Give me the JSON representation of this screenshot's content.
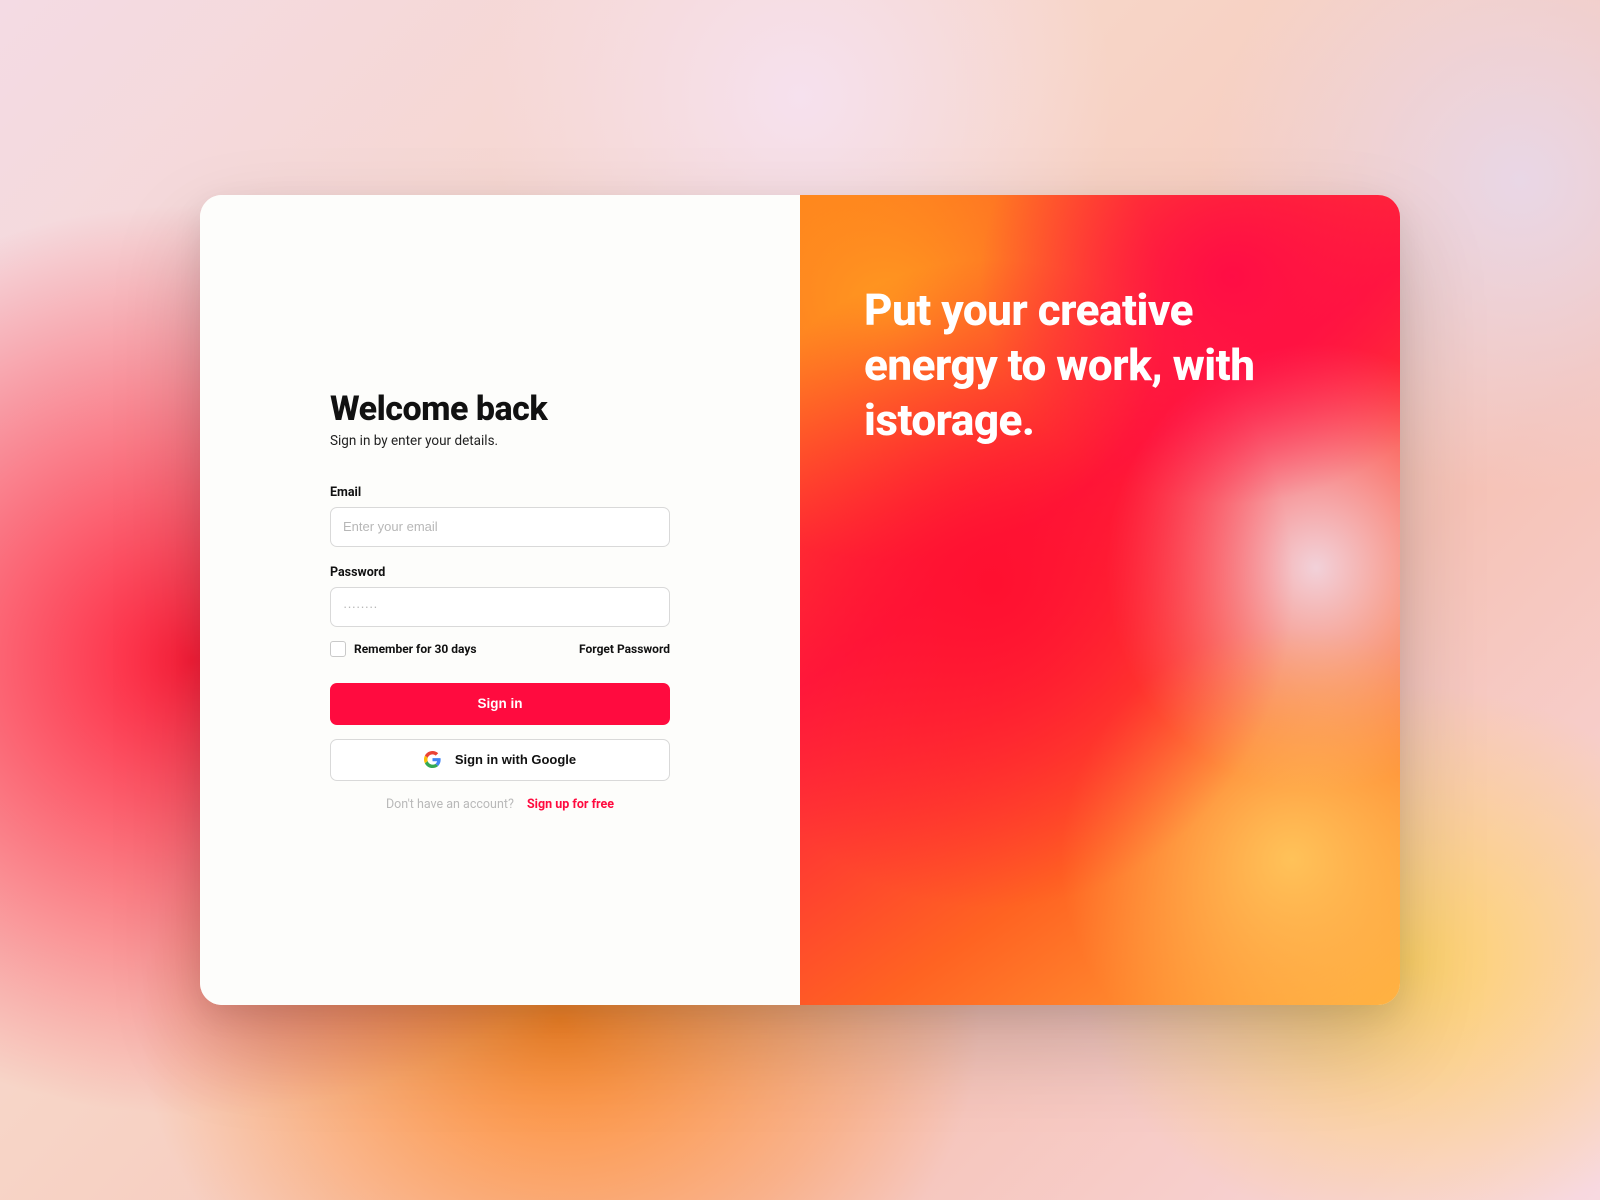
{
  "title": "Welcome back",
  "subtitle": "Sign in by enter your details.",
  "email_label": "Email",
  "email_placeholder": "Enter your email",
  "password_label": "Password",
  "password_placeholder": "········",
  "remember_label": "Remember for 30 days",
  "forgot_label": "Forget Password",
  "signin_label": "Sign in",
  "google_label": "Sign in with Google",
  "signup_prompt": "Don't have an account?",
  "signup_link": "Sign up for free",
  "hero_text": "Put your creative energy to work, with istorage.",
  "colors": {
    "accent": "#ff0b3f"
  }
}
